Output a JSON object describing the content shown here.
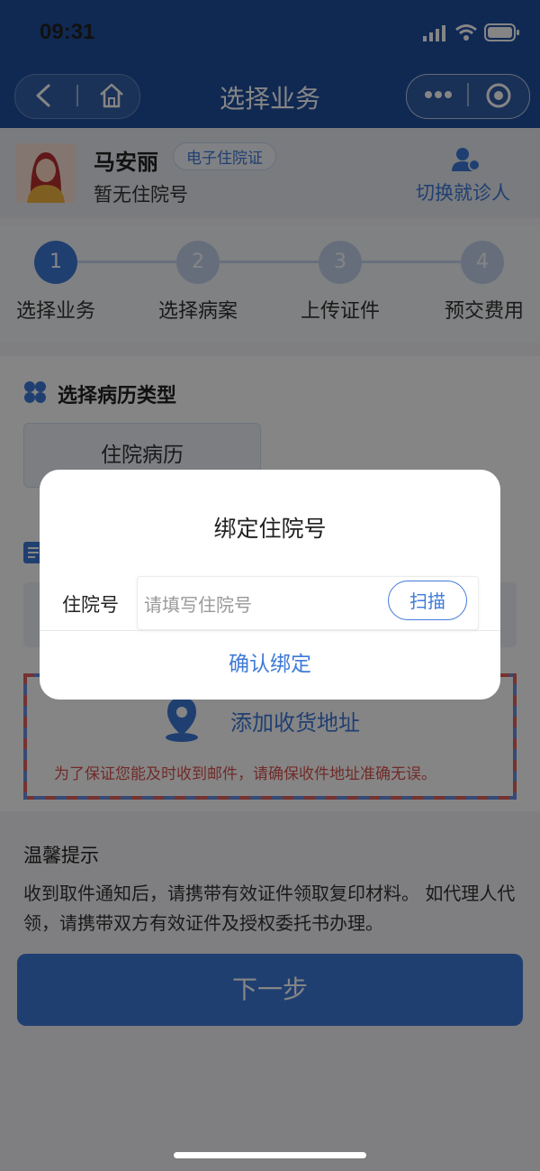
{
  "status_bar": {
    "time": "09:31"
  },
  "nav": {
    "title": "选择业务"
  },
  "patient": {
    "name": "马安丽",
    "card_badge": "电子住院证",
    "inpatient_status": "暂无住院号",
    "switch_label": "切换就诊人"
  },
  "steps": [
    {
      "num": "1",
      "label": "选择业务"
    },
    {
      "num": "2",
      "label": "选择病案"
    },
    {
      "num": "3",
      "label": "上传证件"
    },
    {
      "num": "4",
      "label": "预交费用"
    }
  ],
  "record_section": {
    "title": "选择病历类型",
    "options": [
      "住院病历"
    ]
  },
  "address": {
    "add_label": "添加收货地址",
    "warning": "为了保证您能及时收到邮件，请确保收件地址准确无误。"
  },
  "tips": {
    "title": "温馨提示",
    "text": "收到取件通知后，请携带有效证件领取复印材料。 如代理人代领，请携带双方有效证件及授权委托书办理。"
  },
  "next_button": "下一步",
  "modal": {
    "title": "绑定住院号",
    "field_label": "住院号",
    "placeholder": "请填写住院号",
    "scan_label": "扫描",
    "confirm_label": "确认绑定"
  },
  "colors": {
    "brand": "#1f4fa0",
    "accent": "#3f7ad8",
    "warning": "#d9534f"
  }
}
